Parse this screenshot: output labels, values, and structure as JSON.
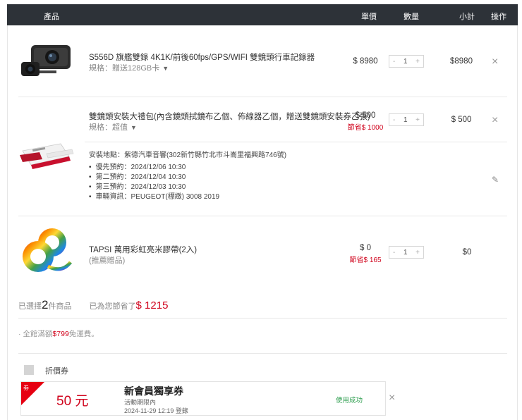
{
  "header": {
    "product": "產品",
    "unit_price": "單價",
    "quantity": "數量",
    "subtotal": "小計",
    "action": "操作"
  },
  "items": [
    {
      "name": "S556D 旗艦雙錄 4K1K/前後60fps/GPS/WIFI 雙鏡頭行車記錄器",
      "spec": "規格：贈送128GB卡",
      "price": "$ 8980",
      "qty": "1",
      "subtotal": "$8980"
    },
    {
      "name": "雙鏡頭安裝大禮包(內含鏡頭拭鏡布乙個、佈線器乙個，贈送雙鏡頭安裝券乙張)",
      "spec": "規格：超值",
      "price": "$ 500",
      "save": "節省$ 1000",
      "qty": "1",
      "subtotal": "$ 500",
      "install": {
        "location": "安裝地點：紫德汽車音響(302新竹縣竹北市斗崙里福興路746號)",
        "details": [
          "優先預約：2024/12/06 10:30",
          "第二預約：2024/12/04 10:30",
          "第三預約：2024/12/03 10:30",
          "車輛資訊：PEUGEOT(標緻) 3008 2019"
        ]
      }
    },
    {
      "name": "TAPSI 萬用彩虹亮米膠帶(2入)",
      "spec": "(推薦贈品)",
      "price": "$ 0",
      "save": "節省$ 165",
      "qty": "1",
      "subtotal": "$0"
    }
  ],
  "qty_minus": "-",
  "qty_plus": "+",
  "close_glyph": "×",
  "edit_glyph": "✎",
  "caret_glyph": "▼",
  "summary": {
    "selected_prefix": "已選擇",
    "selected_count": "2",
    "selected_suffix": "件商品",
    "saved_prefix": "已為您節省了",
    "saved_amount": "$ 1215"
  },
  "shipping": {
    "prefix": "· 全館滿額",
    "amount": "$799",
    "suffix": "免運費。"
  },
  "coupon_section": {
    "label": "折價券",
    "coupon": {
      "ribbon_text": "劵",
      "amount": "50 元",
      "title": "新會員獨享券",
      "period_label": "活動期限內",
      "expiry": "2024-11-29 12:19 登錄",
      "status": "使用成功"
    }
  },
  "colors": {
    "header_bg": "#2d3238",
    "accent_red": "#d0021b",
    "status_green": "#2e9e4f"
  }
}
